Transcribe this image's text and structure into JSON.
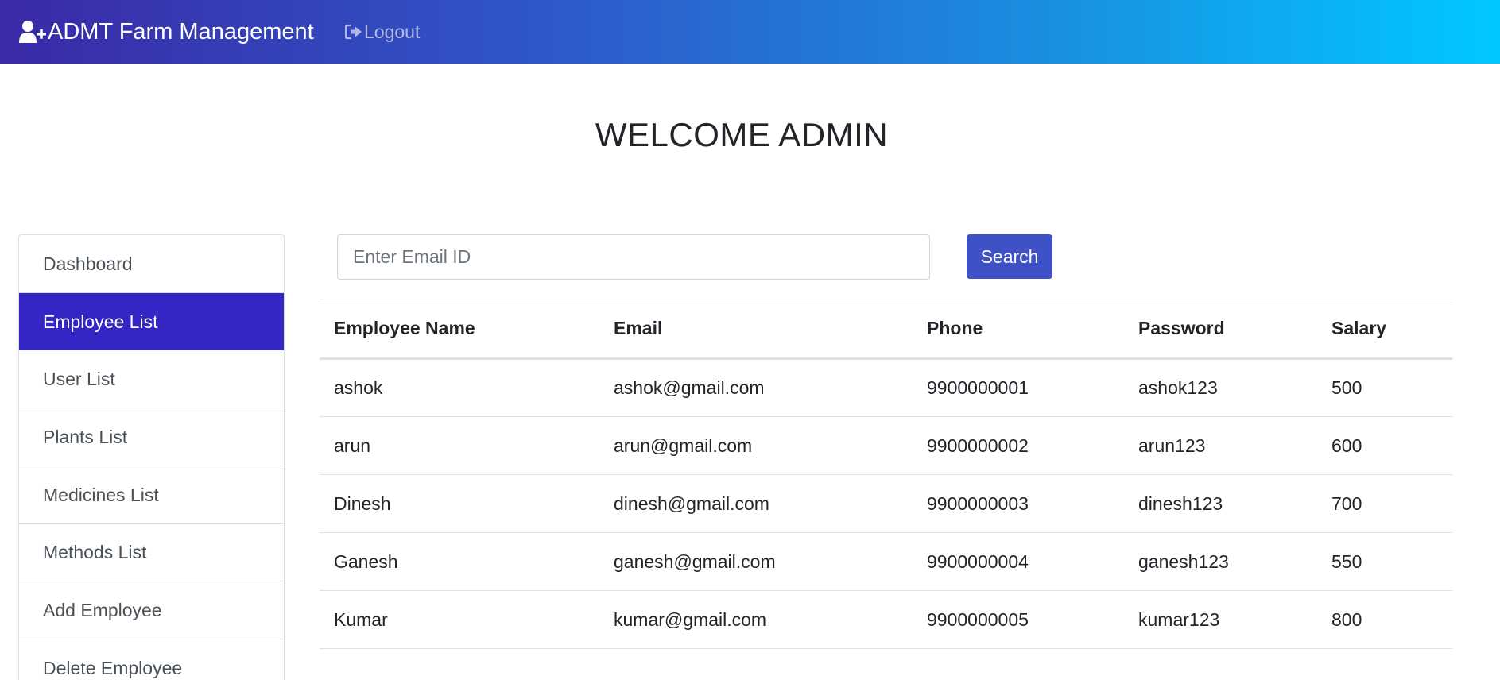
{
  "navbar": {
    "brand": "ADMT Farm Management",
    "brand_icon": "user-plus-icon",
    "logout": "Logout",
    "logout_icon": "sign-out-icon",
    "gradient": [
      "#3a2aa6",
      "#00c8ff"
    ]
  },
  "welcome": "WELCOME ADMIN",
  "sidebar": {
    "items": [
      {
        "label": "Dashboard"
      },
      {
        "label": "Employee List"
      },
      {
        "label": "User List"
      },
      {
        "label": "Plants List"
      },
      {
        "label": "Medicines List"
      },
      {
        "label": "Methods List"
      },
      {
        "label": "Add Employee"
      },
      {
        "label": "Delete Employee"
      }
    ],
    "active_color": "#3326c4"
  },
  "search": {
    "placeholder": "Enter Email ID",
    "value": "",
    "button": "Search",
    "button_color": "#3f51c6"
  },
  "table": {
    "headers": [
      "Employee Name",
      "Email",
      "Phone",
      "Password",
      "Salary"
    ],
    "rows": [
      [
        "ashok",
        "ashok@gmail.com",
        "9900000001",
        "ashok123",
        "500"
      ],
      [
        "arun",
        "arun@gmail.com",
        "9900000002",
        "arun123",
        "600"
      ],
      [
        "Dinesh",
        "dinesh@gmail.com",
        "9900000003",
        "dinesh123",
        "700"
      ],
      [
        "Ganesh",
        "ganesh@gmail.com",
        "9900000004",
        "ganesh123",
        "550"
      ],
      [
        "Kumar",
        "kumar@gmail.com",
        "9900000005",
        "kumar123",
        "800"
      ]
    ]
  }
}
